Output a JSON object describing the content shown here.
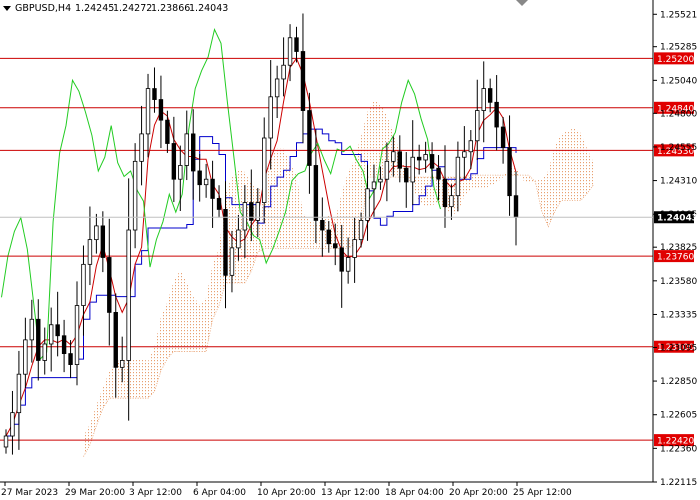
{
  "header": {
    "symbol_label": "GBPUSD,H4",
    "ohlc": [
      "1.24245",
      "1.24272",
      "1.23866",
      "1.24043"
    ]
  },
  "colors": {
    "candle": "#000000",
    "level_line": "#cc0000",
    "level_label_bg": "#e00000",
    "tenkan": "#cc0000",
    "kijun": "#0000cc",
    "chikou": "#22cc22",
    "cloud": "#e8a070",
    "current_price_line": "#c0c0c0",
    "current_price_bg": "#000000"
  },
  "chart_data": {
    "type": "candlestick",
    "timeframe": "H4",
    "ylim": [
      1.22115,
      1.25625
    ],
    "y_ticks": [
      "1.25521",
      "1.25285",
      "1.25040",
      "1.24800",
      "1.24555",
      "1.24310",
      "1.24065",
      "1.23825",
      "1.23580",
      "1.23335",
      "1.23095",
      "1.22850",
      "1.22605",
      "1.22360",
      "1.22115"
    ],
    "x_ticks": [
      "27 Mar 2023",
      "29 Mar 20:00",
      "3 Apr 12:00",
      "6 Apr 04:00",
      "10 Apr 20:00",
      "13 Apr 12:00",
      "18 Apr 04:00",
      "20 Apr 20:00",
      "25 Apr 12:00"
    ],
    "levels": [
      {
        "label": "1.25200",
        "value": 1.252
      },
      {
        "label": "1.24840",
        "value": 1.2484
      },
      {
        "label": "1.24530",
        "value": 1.2453
      },
      {
        "label": "1.23760",
        "value": 1.2376
      },
      {
        "label": "1.23100",
        "value": 1.231
      },
      {
        "label": "1.22420",
        "value": 1.2242
      }
    ],
    "current_price": {
      "label": "1.24043",
      "value": 1.24043
    },
    "closes": [
      1.2245,
      1.2262,
      1.229,
      1.2315,
      1.233,
      1.23,
      1.2312,
      1.2326,
      1.2318,
      1.2305,
      1.2297,
      1.234,
      1.237,
      1.2388,
      1.2398,
      1.2375,
      1.2335,
      1.2295,
      1.23,
      1.2395,
      1.2445,
      1.2465,
      1.2498,
      1.249,
      1.2475,
      1.2458,
      1.2432,
      1.2442,
      1.2465,
      1.2438,
      1.2428,
      1.2432,
      1.2418,
      1.241,
      1.2362,
      1.2382,
      1.2395,
      1.2415,
      1.2402,
      1.2415,
      1.2462,
      1.2492,
      1.2505,
      1.2515,
      1.2535,
      1.2525,
      1.2482,
      1.2442,
      1.2402,
      1.2395,
      1.2385,
      1.2382,
      1.2365,
      1.2375,
      1.2388,
      1.2402,
      1.2425,
      1.243,
      1.2432,
      1.2445,
      1.2452,
      1.244,
      1.243,
      1.2448,
      1.2446,
      1.245,
      1.244,
      1.2432,
      1.2412,
      1.242,
      1.2448,
      1.2452,
      1.246,
      1.2482,
      1.2498,
      1.2488,
      1.247,
      1.2455,
      1.242,
      1.24043
    ]
  }
}
